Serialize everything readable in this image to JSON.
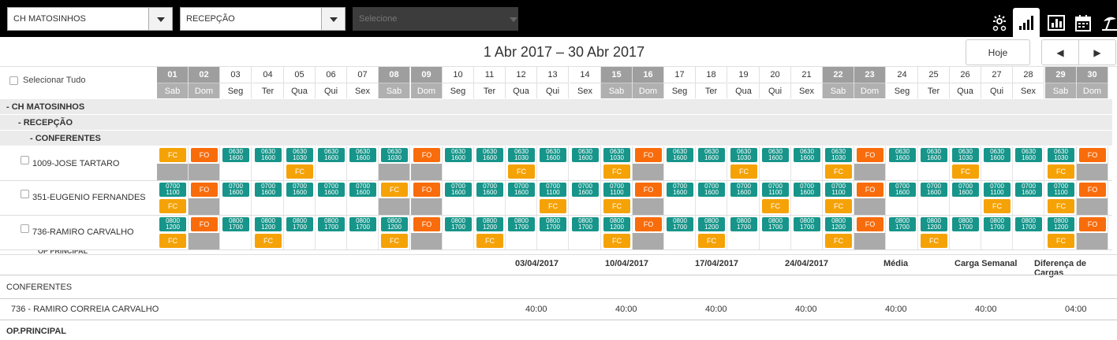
{
  "filters": {
    "unit": "CH MATOSINHOS",
    "sector": "RECEPÇÃO",
    "select_placeholder": "Selecione"
  },
  "toolbar": [
    "sun-network-icon",
    "bar-chart-icon",
    "report-chart-icon",
    "calendar-icon",
    "beach-icon"
  ],
  "nav": {
    "date_range": "1 Abr 2017 – 30 Abr 2017",
    "today": "Hoje",
    "prev": "◀",
    "next": "▶"
  },
  "select_all": "Selecionar Tudo",
  "days": [
    {
      "n": "01",
      "d": "Sab",
      "w": true
    },
    {
      "n": "02",
      "d": "Dom",
      "w": true
    },
    {
      "n": "03",
      "d": "Seg"
    },
    {
      "n": "04",
      "d": "Ter"
    },
    {
      "n": "05",
      "d": "Qua"
    },
    {
      "n": "06",
      "d": "Qui"
    },
    {
      "n": "07",
      "d": "Sex"
    },
    {
      "n": "08",
      "d": "Sab",
      "w": true
    },
    {
      "n": "09",
      "d": "Dom",
      "w": true
    },
    {
      "n": "10",
      "d": "Seg"
    },
    {
      "n": "11",
      "d": "Ter"
    },
    {
      "n": "12",
      "d": "Qua"
    },
    {
      "n": "13",
      "d": "Qui"
    },
    {
      "n": "14",
      "d": "Sex"
    },
    {
      "n": "15",
      "d": "Sab",
      "w": true
    },
    {
      "n": "16",
      "d": "Dom",
      "w": true
    },
    {
      "n": "17",
      "d": "Seg"
    },
    {
      "n": "18",
      "d": "Ter"
    },
    {
      "n": "19",
      "d": "Qua"
    },
    {
      "n": "20",
      "d": "Qui"
    },
    {
      "n": "21",
      "d": "Sex"
    },
    {
      "n": "22",
      "d": "Sab",
      "w": true
    },
    {
      "n": "23",
      "d": "Dom",
      "w": true
    },
    {
      "n": "24",
      "d": "Seg"
    },
    {
      "n": "25",
      "d": "Ter"
    },
    {
      "n": "26",
      "d": "Qua"
    },
    {
      "n": "27",
      "d": "Qui"
    },
    {
      "n": "28",
      "d": "Sex"
    },
    {
      "n": "29",
      "d": "Sab",
      "w": true
    },
    {
      "n": "30",
      "d": "Dom",
      "w": true
    }
  ],
  "groups": [
    "- CH MATOSINHOS",
    "- RECEPÇÃO",
    "- CONFERENTES"
  ],
  "employees": [
    {
      "name": "1009-JOSE TARTARO",
      "top": [
        "FC",
        "FO",
        "0630|1600",
        "0630|1600",
        "0630|1030",
        "0630|1600",
        "0630|1600",
        "0630|1030",
        "FO",
        "0630|1600",
        "0630|1600",
        "0630|1030",
        "0630|1600",
        "0630|1600",
        "0630|1030",
        "FO",
        "0630|1600",
        "0630|1600",
        "0630|1030",
        "0630|1600",
        "0630|1600",
        "0630|1030",
        "FO",
        "0630|1600",
        "0630|1600",
        "0630|1030",
        "0630|1600",
        "0630|1600",
        "0630|1030",
        "FO"
      ],
      "bot": [
        "G",
        "G",
        "",
        "",
        "FC",
        "",
        "",
        "G",
        "G",
        "",
        "",
        "FC",
        "",
        "",
        "FC",
        "G",
        "",
        "",
        "FC",
        "",
        "",
        "FC",
        "G",
        "",
        "",
        "FC",
        "",
        "",
        "FC",
        "G"
      ]
    },
    {
      "name": "351-EUGENIO FERNANDES",
      "top": [
        "0700|1100",
        "FO",
        "0700|1600",
        "0700|1600",
        "0700|1600",
        "0700|1600",
        "0700|1600",
        "FC",
        "FO",
        "0700|1600",
        "0700|1600",
        "0700|1600",
        "0700|1100",
        "0700|1600",
        "0700|1100",
        "FO",
        "0700|1600",
        "0700|1600",
        "0700|1600",
        "0700|1100",
        "0700|1600",
        "0700|1100",
        "FO",
        "0700|1600",
        "0700|1600",
        "0700|1600",
        "0700|1100",
        "0700|1600",
        "0700|1100",
        "FO"
      ],
      "bot": [
        "FC",
        "G",
        "",
        "",
        "",
        "",
        "",
        "G",
        "G",
        "",
        "",
        "",
        "FC",
        "",
        "FC",
        "G",
        "",
        "",
        "",
        "FC",
        "",
        "FC",
        "G",
        "",
        "",
        "",
        "FC",
        "",
        "FC",
        "G"
      ]
    },
    {
      "name": "736-RAMIRO CARVALHO",
      "top": [
        "0800|1200",
        "FO",
        "0800|1700",
        "0800|1200",
        "0800|1700",
        "0800|1700",
        "0800|1700",
        "0800|1200",
        "FO",
        "0800|1700",
        "0800|1200",
        "0800|1700",
        "0800|1700",
        "0800|1700",
        "0800|1200",
        "FO",
        "0800|1700",
        "0800|1200",
        "0800|1700",
        "0800|1700",
        "0800|1700",
        "0800|1200",
        "FO",
        "0800|1700",
        "0800|1200",
        "0800|1700",
        "0800|1700",
        "0800|1700",
        "0800|1200",
        "FO"
      ],
      "bot": [
        "FC",
        "G",
        "",
        "FC",
        "",
        "",
        "",
        "FC",
        "G",
        "",
        "FC",
        "",
        "",
        "",
        "FC",
        "G",
        "",
        "FC",
        "",
        "",
        "",
        "FC",
        "G",
        "",
        "FC",
        "",
        "",
        "",
        "FC",
        "G"
      ]
    }
  ],
  "cut_label": "OP PRINCIPAL",
  "summary": {
    "headers": [
      "03/04/2017",
      "10/04/2017",
      "17/04/2017",
      "24/04/2017",
      "Média",
      "Carga Semanal",
      "Diferença de Cargas"
    ],
    "group1": "CONFERENTES",
    "row_name": "736 - RAMIRO CORREIA CARVALHO",
    "row_values": [
      "40:00",
      "40:00",
      "40:00",
      "40:00",
      "40:00",
      "40:00",
      "04:00"
    ],
    "group2": "OP.PRINCIPAL"
  },
  "colors": {
    "teal": "#17958a",
    "orange": "#f86c0b",
    "yellow": "#f5a207",
    "gray": "#aaaaaa",
    "weekend_header": "#9e9e9e"
  }
}
